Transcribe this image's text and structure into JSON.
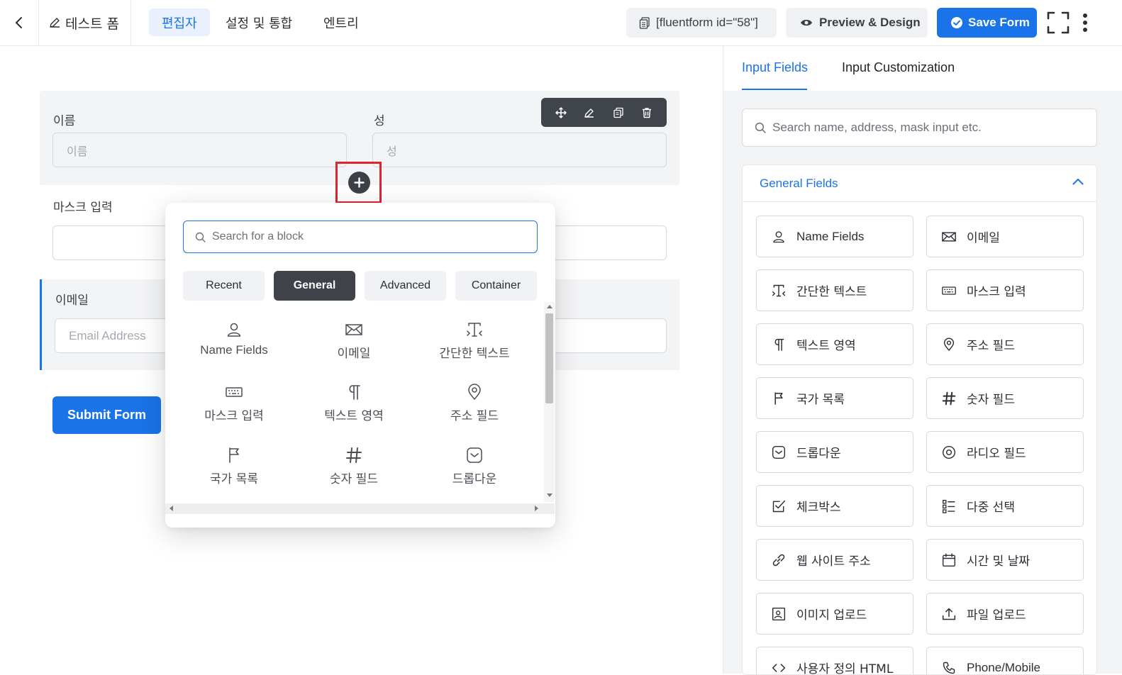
{
  "header": {
    "form_title": "테스트 폼",
    "tabs": [
      {
        "label": "편집자",
        "active": true
      },
      {
        "label": "설정 및 통합",
        "active": false
      },
      {
        "label": "엔트리",
        "active": false
      }
    ],
    "shortcode": "[fluentform id=\"58\"]",
    "preview_label": "Preview & Design",
    "save_label": "Save Form"
  },
  "editor": {
    "first_name": {
      "label": "이름",
      "placeholder": "이름"
    },
    "last_name": {
      "label": "성",
      "placeholder": "성"
    },
    "mask_input": {
      "label": "마스크 입력"
    },
    "email": {
      "label": "이메일",
      "placeholder": "Email Address"
    },
    "submit_label": "Submit Form"
  },
  "popover": {
    "search_placeholder": "Search for a block",
    "tabs": [
      {
        "label": "Recent",
        "active": false
      },
      {
        "label": "General",
        "active": true
      },
      {
        "label": "Advanced",
        "active": false
      },
      {
        "label": "Container",
        "active": false
      }
    ],
    "items": [
      {
        "label": "Name Fields",
        "icon": "user-icon"
      },
      {
        "label": "이메일",
        "icon": "envelope-icon"
      },
      {
        "label": "간단한 텍스트",
        "icon": "text-cursor-icon"
      },
      {
        "label": "마스크 입력",
        "icon": "keyboard-icon"
      },
      {
        "label": "텍스트 영역",
        "icon": "paragraph-icon"
      },
      {
        "label": "주소 필드",
        "icon": "map-pin-icon"
      },
      {
        "label": "국가 목록",
        "icon": "flag-icon"
      },
      {
        "label": "숫자 필드",
        "icon": "hash-icon"
      },
      {
        "label": "드롭다운",
        "icon": "dropdown-icon"
      }
    ]
  },
  "sidebar": {
    "tabs": [
      {
        "label": "Input Fields",
        "active": true
      },
      {
        "label": "Input Customization",
        "active": false
      }
    ],
    "search_placeholder": "Search name, address, mask input etc.",
    "group_title": "General Fields",
    "items": [
      {
        "label": "Name Fields",
        "icon": "user-icon"
      },
      {
        "label": "이메일",
        "icon": "envelope-icon"
      },
      {
        "label": "간단한 텍스트",
        "icon": "text-cursor-icon"
      },
      {
        "label": "마스크 입력",
        "icon": "keyboard-icon"
      },
      {
        "label": "텍스트 영역",
        "icon": "paragraph-icon"
      },
      {
        "label": "주소 필드",
        "icon": "map-pin-icon"
      },
      {
        "label": "국가 목록",
        "icon": "flag-icon"
      },
      {
        "label": "숫자 필드",
        "icon": "hash-icon"
      },
      {
        "label": "드롭다운",
        "icon": "dropdown-icon"
      },
      {
        "label": "라디오 필드",
        "icon": "radio-icon"
      },
      {
        "label": "체크박스",
        "icon": "checkbox-icon"
      },
      {
        "label": "다중 선택",
        "icon": "multi-select-icon"
      },
      {
        "label": "웹 사이트 주소",
        "icon": "link-icon"
      },
      {
        "label": "시간 및 날짜",
        "icon": "calendar-icon"
      },
      {
        "label": "이미지 업로드",
        "icon": "image-icon"
      },
      {
        "label": "파일 업로드",
        "icon": "upload-icon"
      },
      {
        "label": "사용자 정의 HTML",
        "icon": "code-icon"
      },
      {
        "label": "Phone/Mobile",
        "icon": "phone-icon"
      }
    ]
  },
  "colors": {
    "accent": "#1a73e8",
    "highlight_border": "#e0232e",
    "toolbar_bg": "#40454c"
  }
}
